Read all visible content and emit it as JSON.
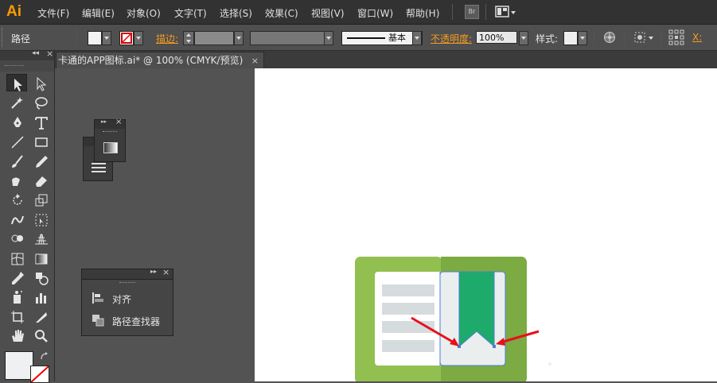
{
  "app": {
    "logo": "Ai"
  },
  "menubar": {
    "items": [
      {
        "label": "文件(F)"
      },
      {
        "label": "编辑(E)"
      },
      {
        "label": "对象(O)"
      },
      {
        "label": "文字(T)"
      },
      {
        "label": "选择(S)"
      },
      {
        "label": "效果(C)"
      },
      {
        "label": "视图(V)"
      },
      {
        "label": "窗口(W)"
      },
      {
        "label": "帮助(H)"
      }
    ],
    "bridge_label": "Br"
  },
  "control_bar": {
    "object_type": "路径",
    "stroke_label": "描边:",
    "stroke_style": "基本",
    "opacity_label": "不透明度:",
    "opacity_value": "100%",
    "style_label": "样式:",
    "x_label": "X:",
    "fill_color": "#f0f2f3"
  },
  "document_tab": {
    "title": "卡通的APP图标.ai* @ 100% (CMYK/预览)",
    "close": "×"
  },
  "toolbox": {
    "collapse": "◂◂",
    "close": "×",
    "tools": [
      "selection-tool-icon",
      "direct-selection-tool-icon",
      "magic-wand-tool-icon",
      "lasso-tool-icon",
      "pen-tool-icon",
      "type-tool-icon",
      "line-segment-tool-icon",
      "rectangle-tool-icon",
      "paintbrush-tool-icon",
      "pencil-tool-icon",
      "blob-brush-tool-icon",
      "eraser-tool-icon",
      "rotate-tool-icon",
      "scale-tool-icon",
      "warp-tool-icon",
      "free-transform-tool-icon",
      "shape-builder-tool-icon",
      "perspective-grid-tool-icon",
      "mesh-tool-icon",
      "gradient-tool-icon",
      "eyedropper-tool-icon",
      "blend-tool-icon",
      "symbol-sprayer-tool-icon",
      "column-graph-tool-icon",
      "artboard-tool-icon",
      "slice-tool-icon",
      "hand-tool-icon",
      "zoom-tool-icon"
    ]
  },
  "panels": {
    "align_label": "对齐",
    "pathfinder_label": "路径查找器",
    "panel_close": "×",
    "panel_expand": "▸▸"
  },
  "colors": {
    "icon_bg_light": "#92c050",
    "icon_bg_dark": "#7bab42",
    "page_white": "#ffffff",
    "page_gray": "#eaeeef",
    "text_lines": "#d6dbde",
    "bookmark_green": "#1eaa6a",
    "annotation_red": "#e8101a",
    "selection_blue": "#4a7fd4"
  }
}
